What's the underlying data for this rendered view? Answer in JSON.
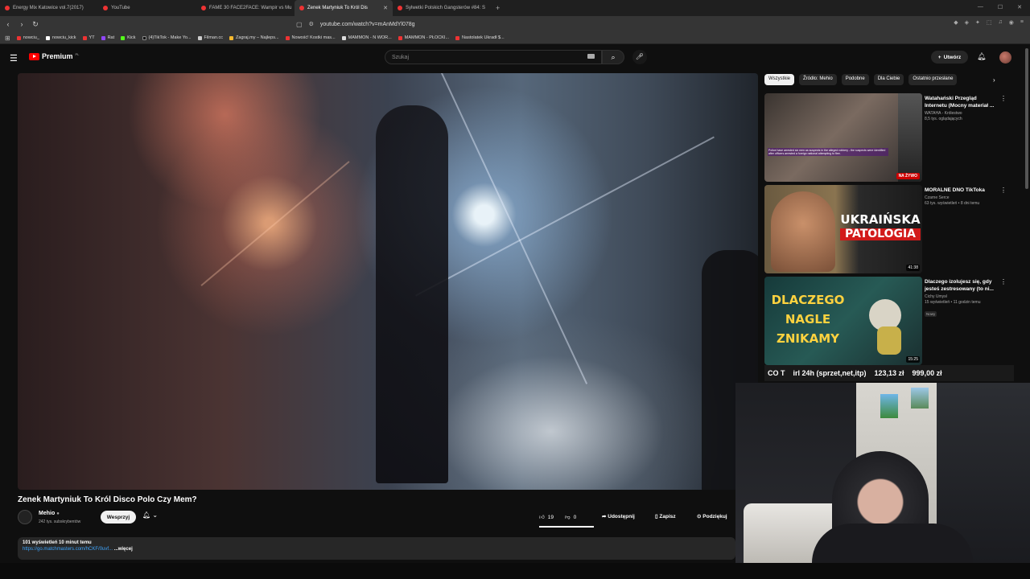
{
  "browser": {
    "tabs": [
      {
        "label": "Energy Mix Katowice vol.7(2017)"
      },
      {
        "label": "YouTube"
      },
      {
        "label": "FAME 30 FACE2FACE: Wampir vs Mu"
      },
      {
        "label": "Zenek Martyniuk To Król Dis"
      },
      {
        "label": "Sylwetki Polskich Gangsterów #84: S"
      }
    ],
    "url": "youtube.com/watch?v=mAnMdYl078g",
    "bookmarks": [
      {
        "label": "nowciu_"
      },
      {
        "label": "nowciu_kick"
      },
      {
        "label": "YT"
      },
      {
        "label": "Rat"
      },
      {
        "label": "Kick"
      },
      {
        "label": "(4)TikTok - Make Yo..."
      },
      {
        "label": "Filman.cc"
      },
      {
        "label": "Zagraj.my – Najleps..."
      },
      {
        "label": "Nowość! Kostki mas..."
      },
      {
        "label": "MAMMON - N WOR..."
      },
      {
        "label": "MAMMON - PŁOCKI..."
      },
      {
        "label": "Nastolatek Ukradł $..."
      }
    ]
  },
  "header": {
    "logo": "Premium",
    "logo_region": "PL",
    "search_placeholder": "Szukaj",
    "create_label": "Utwórz"
  },
  "video": {
    "title": "Zenek Martyniuk To Król Disco Polo Czy Mem?",
    "channel": "Mehio",
    "subscribers": "242 tys. subskrybentów",
    "support_label": "Wesprzyj",
    "likes": "19",
    "dislikes": "0",
    "like_ratio": 1.0,
    "share_label": "Udostępnij",
    "save_label": "Zapisz",
    "thanks_label": "Podziękuj",
    "views_time": "101 wyświetleń  10 minut temu",
    "desc_link": "https://go.matchmasters.com/hCKF/0uvf...",
    "more_label": "...więcej"
  },
  "chips": [
    "Wszystkie",
    "Źródło: Mehio",
    "Podobne",
    "Dla Ciebie",
    "Ostatnio przesłane"
  ],
  "recommendations": [
    {
      "title": "Watahański Przegląd Internetu (Mocny materiał ...",
      "channel": "WATAHA - Królestwo",
      "views": "8,5 tys. oglądających",
      "badge": "NA ŻYWO",
      "thumb_caption": "Police have arrested six men as suspects in the alleged robbery - the suspects were identified after officers arrested a foreign national attempting to flee."
    },
    {
      "title": "MORALNE DNO TikToka",
      "channel": "Czarne Serce",
      "views": "63 tys. wyświetleń • 8 dni temu",
      "duration": "41:38",
      "thumb_text_1": "UKRAIŃSKA",
      "thumb_text_2": "PATOLOGIA"
    },
    {
      "title": "Dlaczego izolujesz się, gdy jesteś zestresowany (to ni...",
      "channel": "Cichy Umysł",
      "views": "15 wyświetleń • 11 godzin temu",
      "new_badge": "Nowy",
      "duration": "15:25",
      "thumb_text_1": "DLACZEGO",
      "thumb_text_2": "NAGLE",
      "thumb_text_3": "ZNIKAMY"
    }
  ],
  "overlay": {
    "left": "CO T",
    "text": "irl 24h (sprzet,net,itp)",
    "amount": "123,13 zł",
    "goal": "999,00 zł"
  },
  "colors": {
    "accent": "#ff0000",
    "link": "#3ea6ff",
    "live": "#cc0000"
  }
}
